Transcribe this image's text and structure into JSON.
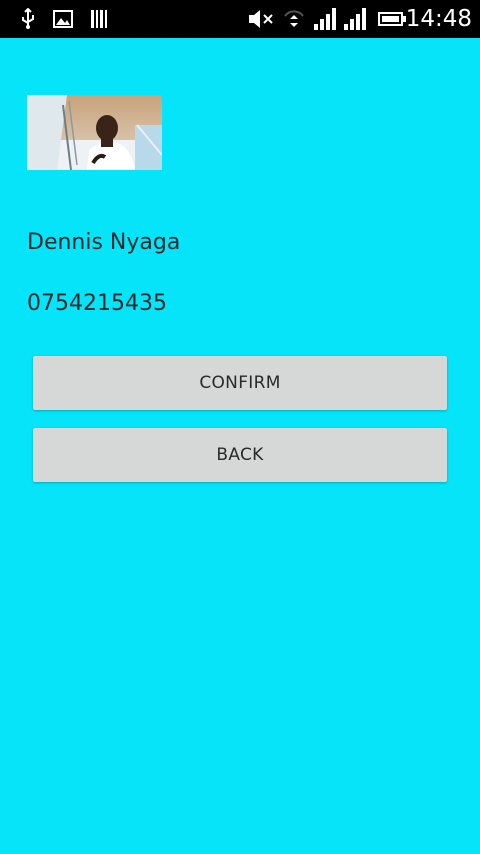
{
  "status_bar": {
    "time": "14:48",
    "icons": [
      "usb-icon",
      "image-icon",
      "barcode-icon",
      "mute-icon",
      "data-transfer-icon",
      "signal-icon",
      "signal-icon-2",
      "battery-icon"
    ]
  },
  "profile": {
    "photo_icon": "profile-photo",
    "name": "Dennis Nyaga",
    "phone": "0754215435"
  },
  "actions": {
    "confirm_label": "CONFIRM",
    "back_label": "BACK"
  },
  "colors": {
    "background": "#05e4f8",
    "status_bar": "#000000",
    "button": "#d6d7d7"
  }
}
